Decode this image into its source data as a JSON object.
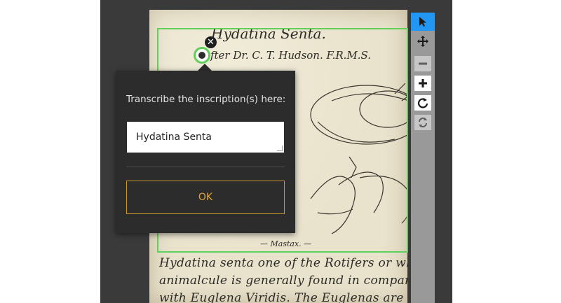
{
  "page": {
    "title_inscription": "Hydatina Senta.",
    "byline_inscription": "after Dr. C. T. Hudson. F.R.M.S.",
    "figure_caption": "— Mastax. —",
    "handwritten_lines": [
      "Hydatina senta one of the Rotifers or wheel",
      "animalcule is generally found in company",
      "with Euglena Viridis.   The Euglenas are eaten"
    ]
  },
  "popup": {
    "prompt": "Transcribe the inscription(s) here:",
    "input_value": "Hydatina Senta",
    "ok_label": "OK"
  },
  "toolbar": {
    "tools": [
      {
        "icon": "pointer-icon",
        "state": "active"
      },
      {
        "icon": "pan-icon",
        "state": "enabled"
      },
      {
        "icon": "zoom-out-icon",
        "state": "disabled"
      },
      {
        "icon": "zoom-in-icon",
        "state": "enabled"
      },
      {
        "icon": "rotate-icon",
        "state": "enabled"
      },
      {
        "icon": "reset-icon",
        "state": "disabled"
      }
    ]
  },
  "colors": {
    "selection": "#5fd15a",
    "active_tool": "#2196f3",
    "ok_accent": "#e0a631",
    "popup_bg": "#2c2c2c"
  }
}
